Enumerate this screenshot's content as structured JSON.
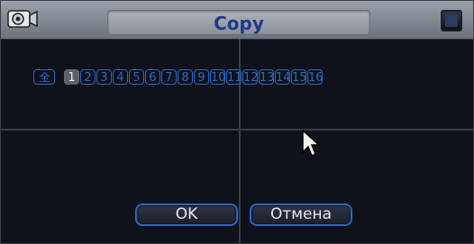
{
  "dialog": {
    "title": "Copy",
    "logo_icon": "video-camera-logo-icon",
    "close_icon": "close-icon"
  },
  "channels": {
    "all_label": "全",
    "items": [
      "1",
      "2",
      "3",
      "4",
      "5",
      "6",
      "7",
      "8",
      "9",
      "10",
      "11",
      "12",
      "13",
      "14",
      "15",
      "16"
    ],
    "selected": "1"
  },
  "buttons": {
    "ok_label": "OK",
    "cancel_label": "Отмена"
  },
  "colors": {
    "accent": "#2b67c6",
    "title_text": "#1f3a8a",
    "background": "#0f121a"
  },
  "cursor_icon": "mouse-pointer-icon"
}
